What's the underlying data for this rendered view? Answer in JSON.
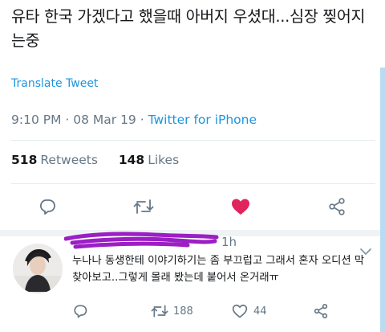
{
  "tweet": {
    "text": "유타 한국 가겠다고 했을때 아버지 우셨대...심장 찢어지는중",
    "translate_label": "Translate Tweet",
    "time": "9:10 PM",
    "date": "08 Mar 19",
    "via": "Twitter for iPhone",
    "retweets_count": "518",
    "retweets_label": "Retweets",
    "likes_count": "148",
    "likes_label": "Likes",
    "liked": true,
    "like_color": "#e0245e"
  },
  "reply": {
    "name": "",
    "time": "1h",
    "text": "누나나 동생한테 이야기하기는 좀 부끄럽고 그래서 혼자 오디션 막 찾아보고..그렇게 몰래 봤는데 붙어서 온거래ㅠ",
    "retweets_count": "188",
    "likes_count": "44",
    "redaction_color": "#9b1fc4"
  },
  "icons": {
    "reply": "reply-icon",
    "retweet": "retweet-icon",
    "like": "heart-icon",
    "share": "share-icon",
    "menu": "chevron-down-icon"
  },
  "colors": {
    "accent": "#1b95e0",
    "secondary_text": "#657786",
    "like": "#e0245e"
  }
}
